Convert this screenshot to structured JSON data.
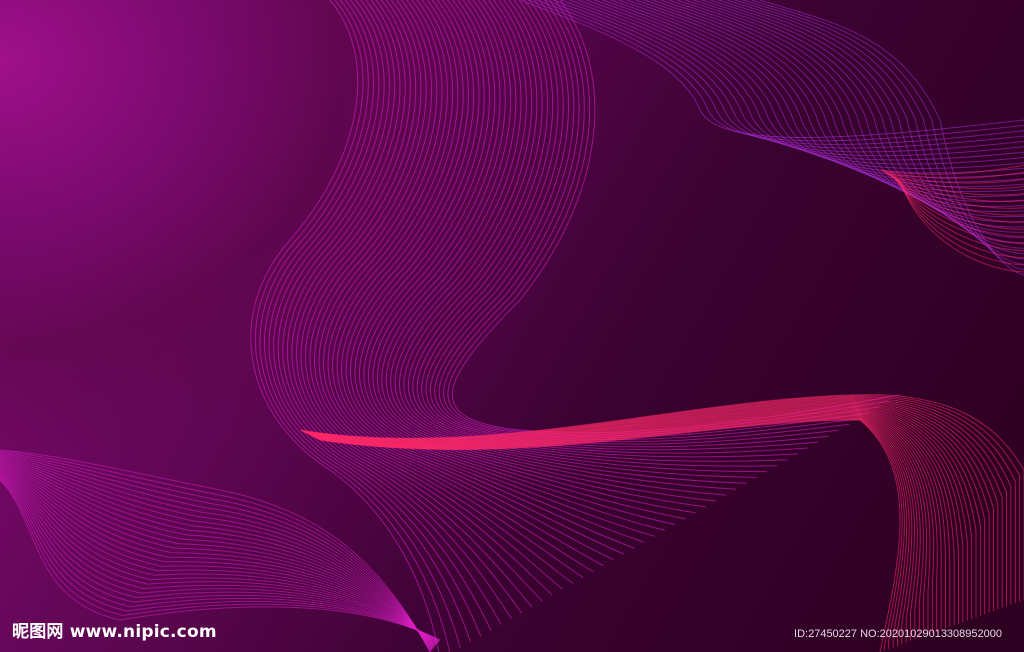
{
  "watermark": {
    "site_cn": "昵图网",
    "site_url": "www.nipic.com",
    "id_text": "ID:27450227 NO:20201029013308952000"
  },
  "palette": {
    "background_dark": "#2a0018",
    "background_light": "#8a0c7c",
    "line_magenta": "#e020c8",
    "line_pink": "#ff2a6a",
    "line_violet": "#b030e0"
  }
}
